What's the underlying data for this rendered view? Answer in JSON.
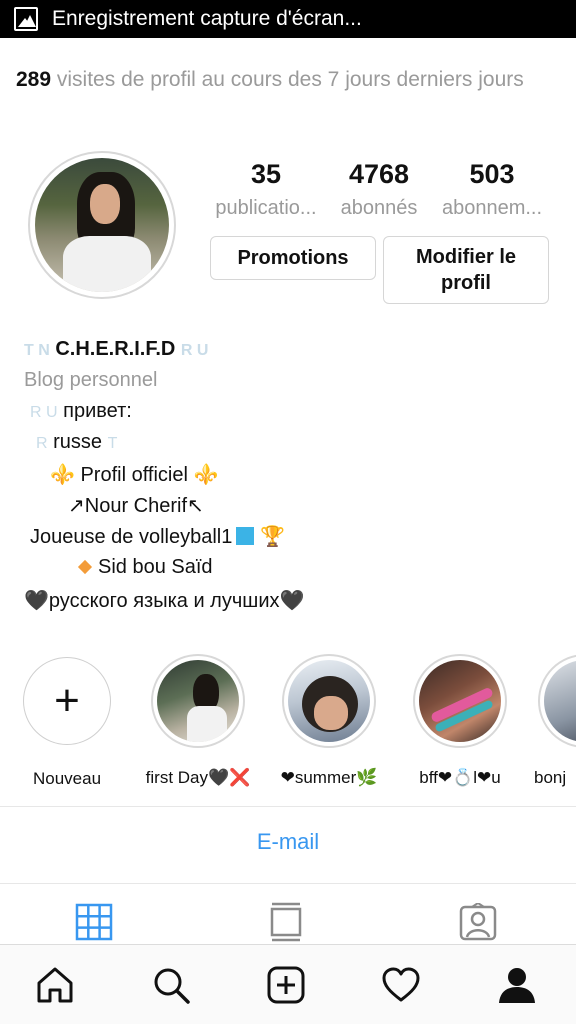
{
  "status_bar": {
    "text": "Enregistrement capture d'écran..."
  },
  "visits": {
    "count": "289",
    "text": "visites de profil au cours des 7 jours derniers jours"
  },
  "stats": [
    {
      "value": "35",
      "label": "publicatio..."
    },
    {
      "value": "4768",
      "label": "abonnés"
    },
    {
      "value": "503",
      "label": "abonnem..."
    }
  ],
  "buttons": {
    "promotions": "Promotions",
    "edit_profile": "Modifier le profil"
  },
  "bio": {
    "name_prefix": "T N",
    "name": "C.H.E.R.I.F.D",
    "name_suffix": "R U",
    "category": "Blog personnel",
    "line1_prefix": "R U",
    "line1": "привет:",
    "line2_prefix": "R",
    "line2": "russe",
    "line2_suffix": "T",
    "line3": "⚜️ Profil officiel ⚜️",
    "line4": "↗Nour Cherif↖",
    "line5": "Joueuse de volleyball1",
    "line5_trophy": "🏆",
    "line6": "Sid bou Saïd",
    "line7": "🖤русского языка и лучших🖤"
  },
  "highlights": [
    {
      "label": "Nouveau"
    },
    {
      "label": "first Day🖤❌"
    },
    {
      "label": "❤summer🌿"
    },
    {
      "label": "bff❤💍l❤u"
    },
    {
      "label": "bonj"
    }
  ],
  "email": {
    "label": "E-mail"
  },
  "colors": {
    "accent": "#3897f0",
    "muted": "#9a9a9a",
    "text": "#111111"
  },
  "icons": {
    "tabs": [
      "grid-icon",
      "feed-icon",
      "tagged-icon"
    ],
    "nav": [
      "home-icon",
      "search-icon",
      "add-icon",
      "heart-icon",
      "profile-icon"
    ]
  }
}
